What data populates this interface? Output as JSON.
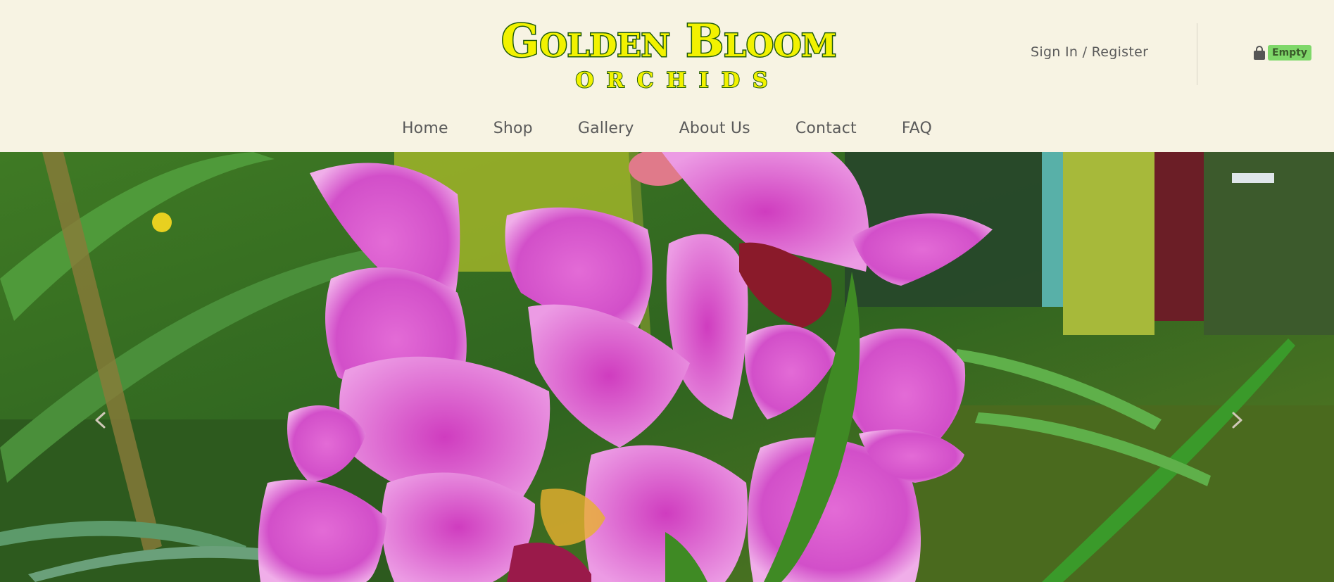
{
  "brand": {
    "name_line1": "Golden Bloom",
    "name_line2": "ORCHIDS",
    "color_fill": "#f2f200",
    "color_outline": "#1f5a0a"
  },
  "account": {
    "signin_label": "Sign In / Register"
  },
  "cart": {
    "icon": "shopping-bag-icon",
    "badge_text": "Empty",
    "badge_color": "#7fd86a"
  },
  "nav": {
    "items": [
      {
        "label": "Home"
      },
      {
        "label": "Shop"
      },
      {
        "label": "Gallery"
      },
      {
        "label": "About Us"
      },
      {
        "label": "Contact"
      },
      {
        "label": "FAQ"
      }
    ]
  },
  "carousel": {
    "slide_image": "pink-orchid-photo",
    "prev_icon": "chevron-left-icon",
    "next_icon": "chevron-right-icon"
  },
  "colors": {
    "header_bg": "#f7f3e3",
    "nav_text": "#5a5a5a"
  }
}
